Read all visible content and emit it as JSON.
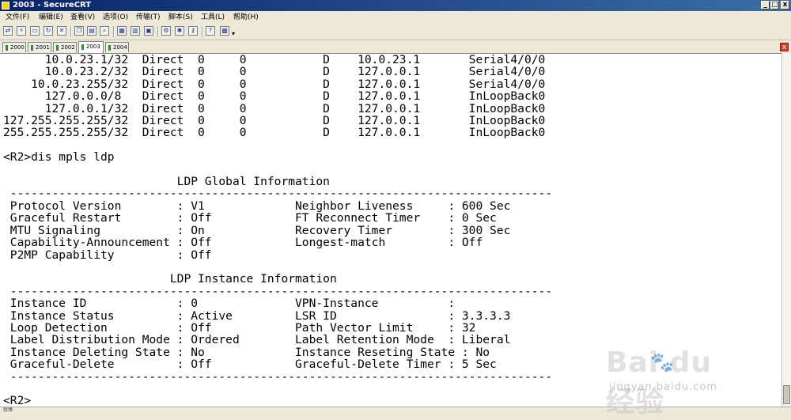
{
  "window": {
    "title": "2003 - SecureCRT",
    "controls": {
      "minimize": "_",
      "maximize": "□",
      "close": "x"
    }
  },
  "menu": [
    "文件(F)",
    "编辑(E)",
    "查看(V)",
    "选项(O)",
    "传输(T)",
    "脚本(S)",
    "工具(L)",
    "帮助(H)"
  ],
  "toolbar": {
    "icons": [
      "connect-icon",
      "quick-connect-icon",
      "connect-tab-icon",
      "reconnect-icon",
      "disconnect-icon",
      "copy-icon",
      "paste-icon",
      "find-icon",
      "print-icon",
      "print-setup-icon",
      "map-icon",
      "session-options-icon",
      "global-options-icon",
      "key-icon",
      "sftp-icon",
      "help-icon",
      "keymap-icon"
    ]
  },
  "tabs": [
    {
      "label": "2000",
      "active": false
    },
    {
      "label": "2001",
      "active": false
    },
    {
      "label": "2002",
      "active": false
    },
    {
      "label": "2003",
      "active": true
    },
    {
      "label": "2004",
      "active": false
    }
  ],
  "tab_close": "x",
  "terminal": {
    "lines": [
      "      10.0.23.1/32  Direct  0     0           D    10.0.23.1       Serial4/0/0",
      "      10.0.23.2/32  Direct  0     0           D    127.0.0.1       Serial4/0/0",
      "    10.0.23.255/32  Direct  0     0           D    127.0.0.1       Serial4/0/0",
      "      127.0.0.0/8   Direct  0     0           D    127.0.0.1       InLoopBack0",
      "      127.0.0.1/32  Direct  0     0           D    127.0.0.1       InLoopBack0",
      "127.255.255.255/32  Direct  0     0           D    127.0.0.1       InLoopBack0",
      "255.255.255.255/32  Direct  0     0           D    127.0.0.1       InLoopBack0",
      "",
      "<R2>dis mpls ldp",
      "",
      "                         LDP Global Information",
      " ------------------------------------------------------------------------------",
      " Protocol Version        : V1             Neighbor Liveness     : 600 Sec",
      " Graceful Restart        : Off            FT Reconnect Timer    : 0 Sec",
      " MTU Signaling           : On             Recovery Timer        : 300 Sec",
      " Capability-Announcement : Off            Longest-match         : Off",
      " P2MP Capability         : Off",
      "",
      "                        LDP Instance Information",
      " ------------------------------------------------------------------------------",
      " Instance ID             : 0              VPN-Instance          :",
      " Instance Status         : Active         LSR ID                : 3.3.3.3",
      " Loop Detection          : Off            Path Vector Limit     : 32",
      " Label Distribution Mode : Ordered        Label Retention Mode  : Liberal",
      " Instance Deleting State : No             Instance Reseting State : No",
      " Graceful-Delete         : Off            Graceful-Delete Timer : 5 Sec",
      " ------------------------------------------------------------------------------",
      "",
      "<R2>"
    ]
  },
  "statusbar": {
    "left": "就绪"
  },
  "watermark": {
    "brand": "Bai  du 经验",
    "paw": "🐾",
    "site": "jingyan.baidu.com"
  }
}
